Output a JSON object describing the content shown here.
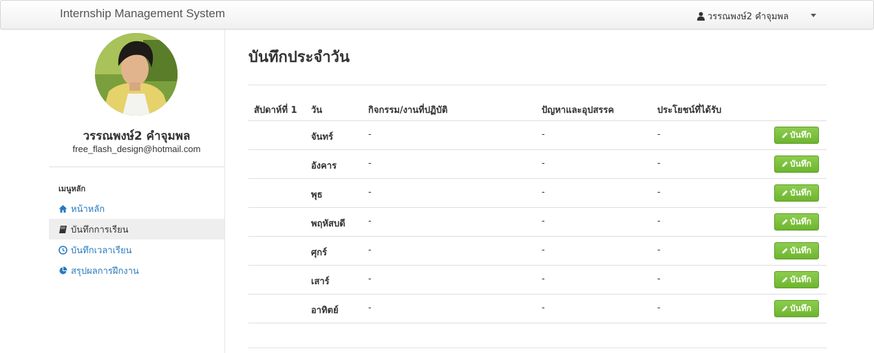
{
  "navbar": {
    "brand": "Internship Management System",
    "user_name": "วรรณพงษ์2 คำจุมพล"
  },
  "profile": {
    "name": "วรรณพงษ์2 คำจุมพล",
    "email": "free_flash_design@hotmail.com"
  },
  "sidebar": {
    "heading": "เมนูหลัก",
    "items": [
      {
        "label": "หน้าหลัก",
        "icon": "home-icon"
      },
      {
        "label": "บันทึกการเรียน",
        "icon": "book-icon"
      },
      {
        "label": "บันทึกเวลาเรียน",
        "icon": "clock-icon"
      },
      {
        "label": "สรุปผลการฝึกงาน",
        "icon": "pie-chart-icon"
      }
    ],
    "active_index": 1
  },
  "main": {
    "title": "บันทึกประจำวัน",
    "week_label": "สัปดาห์ที่ 1",
    "columns": [
      "วัน",
      "กิจกรรม/งานที่ปฏิบัติ",
      "ปัญหาและอุปสรรค",
      "ประโยชน์ที่ได้รับ"
    ],
    "rows": [
      {
        "day": "จันทร์",
        "activity": "-",
        "problem": "-",
        "benefit": "-"
      },
      {
        "day": "อังคาร",
        "activity": "-",
        "problem": "-",
        "benefit": "-"
      },
      {
        "day": "พุธ",
        "activity": "-",
        "problem": "-",
        "benefit": "-"
      },
      {
        "day": "พฤหัสบดี",
        "activity": "-",
        "problem": "-",
        "benefit": "-"
      },
      {
        "day": "ศุกร์",
        "activity": "-",
        "problem": "-",
        "benefit": "-"
      },
      {
        "day": "เสาร์",
        "activity": "-",
        "problem": "-",
        "benefit": "-"
      },
      {
        "day": "อาทิตย์",
        "activity": "-",
        "problem": "-",
        "benefit": "-"
      }
    ],
    "save_label": "บันทึก"
  },
  "colors": {
    "link": "#2a7ac1",
    "success": "#7cc242"
  }
}
